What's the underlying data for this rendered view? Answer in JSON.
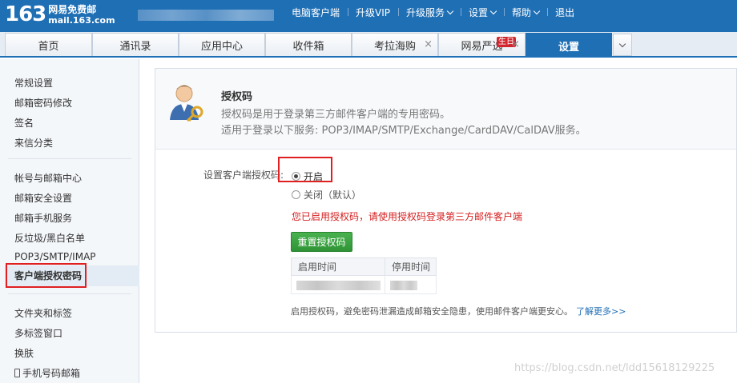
{
  "header": {
    "logo_num": "163",
    "logo_cn": "网易免费邮",
    "logo_url": "mail.163.com",
    "nav": [
      {
        "label": "电脑客户端",
        "caret": false
      },
      {
        "label": "升级VIP",
        "caret": false
      },
      {
        "label": "升级服务",
        "caret": true
      },
      {
        "label": "设置",
        "caret": true
      },
      {
        "label": "帮助",
        "caret": true
      },
      {
        "label": "退出",
        "caret": false
      }
    ]
  },
  "tabs": [
    {
      "label": "首页"
    },
    {
      "label": "通讯录"
    },
    {
      "label": "应用中心"
    },
    {
      "label": "收件箱"
    },
    {
      "label": "考拉海购",
      "close": "×"
    },
    {
      "label": "网易严选",
      "close": "×",
      "badge": "生日"
    },
    {
      "label": "设置",
      "active": true
    }
  ],
  "sidebar": {
    "group1": [
      "常规设置",
      "邮箱密码修改",
      "签名",
      "来信分类"
    ],
    "group2": [
      "帐号与邮箱中心",
      "邮箱安全设置",
      "邮箱手机服务",
      "反垃圾/黑白名单",
      "POP3/SMTP/IMAP"
    ],
    "active": "客户端授权密码",
    "group3": [
      "文件夹和标签",
      "多标签窗口",
      "换肤"
    ],
    "phone_item": "手机号码邮箱"
  },
  "auth": {
    "title": "授权码",
    "desc1": "授权码是用于登录第三方邮件客户端的专用密码。",
    "desc2": "适用于登录以下服务: POP3/IMAP/SMTP/Exchange/CardDAV/CalDAV服务。"
  },
  "settings": {
    "label": "设置客户端授权码:",
    "option_on": "开启",
    "option_off": "关闭",
    "option_off_note": "（默认）",
    "selected": "on",
    "notice": "您已启用授权码，请使用授权码登录第三方邮件客户端",
    "reset_button": "重置授权码",
    "table_headers": [
      "启用时间",
      "停用时间"
    ],
    "footer_note": "启用授权码，避免密码泄漏造成邮箱安全隐患，使用邮件客户端更安心。",
    "learn_more": "了解更多>>"
  },
  "watermark": "https://blog.csdn.net/ldd15618129225"
}
